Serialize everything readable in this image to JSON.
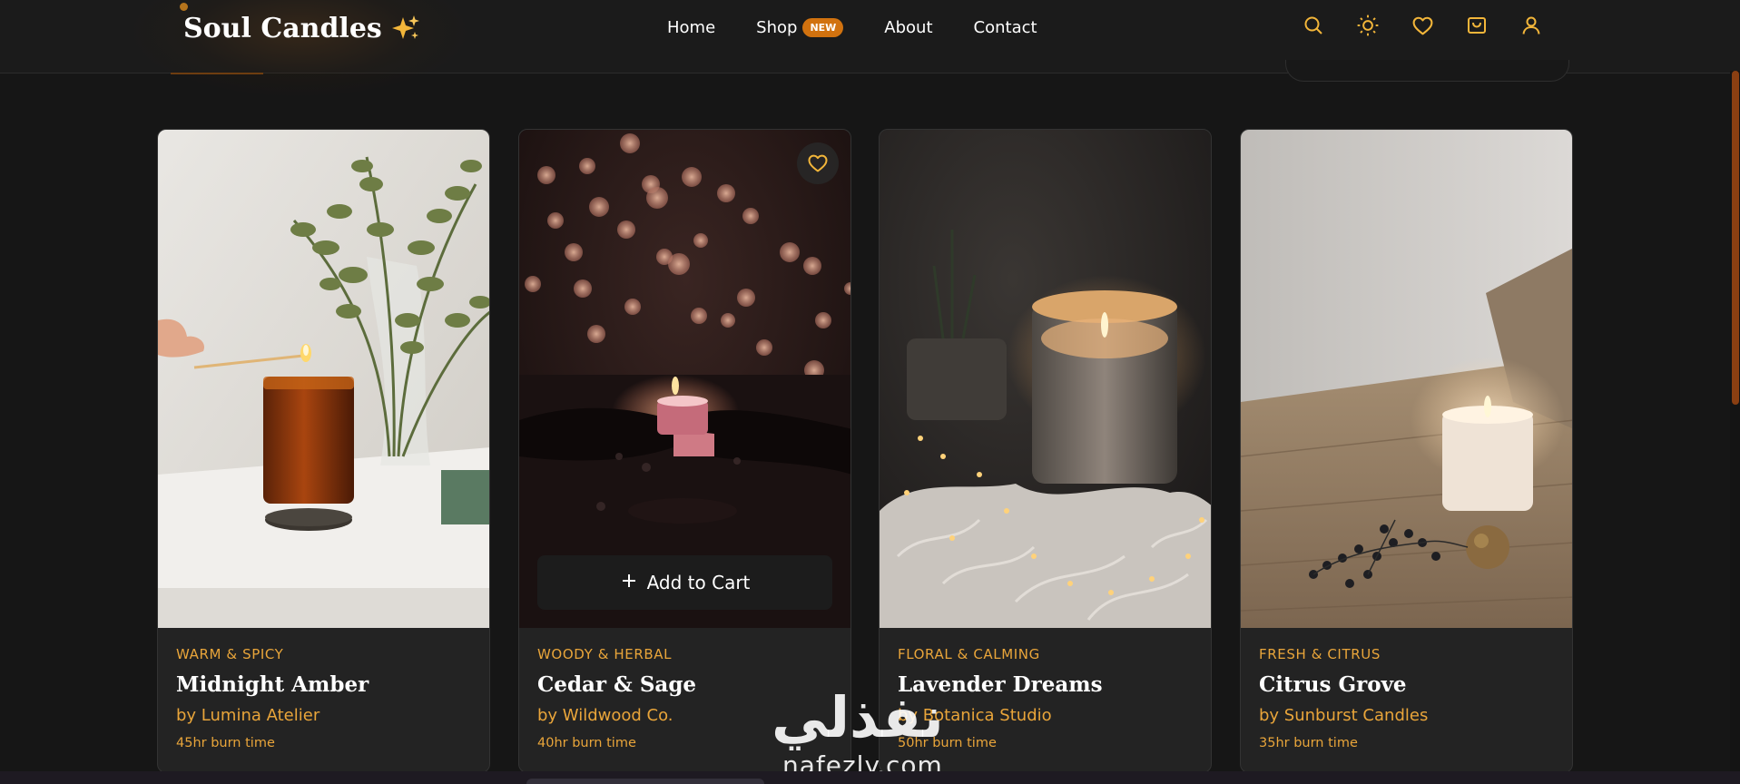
{
  "header": {
    "logo_text": "Soul Candles",
    "logo_icon": "sparkles-icon",
    "nav": [
      {
        "label": "Home"
      },
      {
        "label": "Shop",
        "badge": "NEW"
      },
      {
        "label": "About"
      },
      {
        "label": "Contact"
      }
    ],
    "icons": [
      "search-icon",
      "sun-icon",
      "heart-icon",
      "cart-icon",
      "user-icon"
    ]
  },
  "colors": {
    "background": "#161616",
    "card": "#232323",
    "accent": "#e9a53a",
    "badge": "#d1720f",
    "scroll_thumb": "#8a3f12"
  },
  "products": [
    {
      "category": "WARM & SPICY",
      "name": "Midnight Amber",
      "maker": "by Lumina Atelier",
      "burn": "45hr burn time"
    },
    {
      "category": "WOODY & HERBAL",
      "name": "Cedar & Sage",
      "maker": "by Wildwood Co.",
      "burn": "40hr burn time",
      "wishlist_icon": "heart-outline-icon",
      "cta": "Add to Cart"
    },
    {
      "category": "FLORAL & CALMING",
      "name": "Lavender Dreams",
      "maker": "by Botanica Studio",
      "burn": "50hr burn time"
    },
    {
      "category": "FRESH & CITRUS",
      "name": "Citrus Grove",
      "maker": "by Sunburst Candles",
      "burn": "35hr burn time"
    }
  ],
  "watermark": {
    "arabic": "نفذلي",
    "latin": "nafezly.com"
  }
}
